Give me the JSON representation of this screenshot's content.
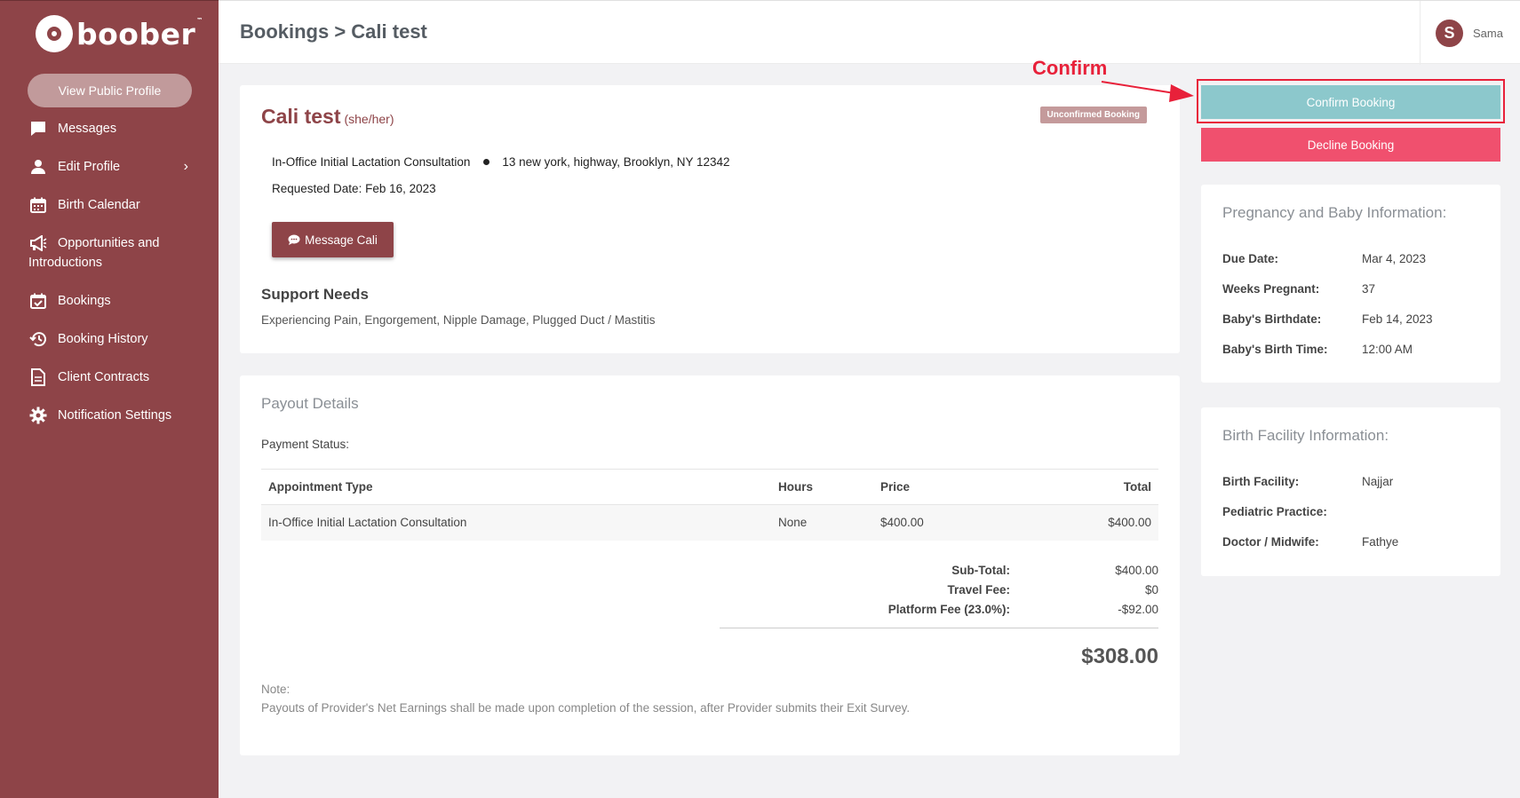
{
  "brand": {
    "name": "boober",
    "tm": "™"
  },
  "sidebar": {
    "public_profile_label": "View Public Profile",
    "items": [
      {
        "label": "Messages",
        "icon": "chat-icon"
      },
      {
        "label": "Edit Profile",
        "icon": "person-icon",
        "chevron": "›"
      },
      {
        "label": "Birth Calendar",
        "icon": "calendar-icon"
      },
      {
        "label": "Opportunities and Introductions",
        "icon": "megaphone-icon"
      },
      {
        "label": "Bookings",
        "icon": "calendar-check-icon"
      },
      {
        "label": "Booking History",
        "icon": "history-icon"
      },
      {
        "label": "Client Contracts",
        "icon": "document-icon"
      },
      {
        "label": "Notification Settings",
        "icon": "gear-icon"
      }
    ]
  },
  "header": {
    "breadcrumb": "Bookings > Cali test",
    "user_initial": "S",
    "user_name": "Sama"
  },
  "client": {
    "name": "Cali test",
    "pronoun": "(she/her)",
    "status": "Unconfirmed Booking",
    "service": "In-Office Initial Lactation Consultation",
    "address": "13 new york, highway, Brooklyn, NY 12342",
    "requested_date": "Requested Date: Feb 16, 2023",
    "message_button": "Message Cali",
    "support_title": "Support Needs",
    "support_text": "Experiencing Pain, Engorgement, Nipple Damage, Plugged Duct / Mastitis"
  },
  "payout": {
    "title": "Payout Details",
    "payment_status_label": "Payment Status:",
    "columns": [
      "Appointment Type",
      "Hours",
      "Price",
      "Total"
    ],
    "rows": [
      [
        "In-Office Initial Lactation Consultation",
        "None",
        "$400.00",
        "$400.00"
      ]
    ],
    "totals": [
      {
        "label": "Sub-Total:",
        "value": "$400.00"
      },
      {
        "label": "Travel Fee:",
        "value": "$0"
      },
      {
        "label": "Platform Fee (23.0%):",
        "value": "-$92.00"
      }
    ],
    "grand_total": "$308.00",
    "note_label": "Note:",
    "note_text": "Payouts of Provider's Net Earnings shall be made upon completion of the session, after Provider submits their Exit Survey."
  },
  "actions": {
    "confirm_label": "Confirm Booking",
    "decline_label": "Decline Booking",
    "annotation": "Confirm"
  },
  "pregnancy": {
    "title": "Pregnancy and Baby Information:",
    "rows": [
      {
        "key": "Due Date:",
        "value": "Mar 4, 2023"
      },
      {
        "key": "Weeks Pregnant:",
        "value": "37"
      },
      {
        "key": "Baby's Birthdate:",
        "value": "Feb 14, 2023"
      },
      {
        "key": "Baby's Birth Time:",
        "value": "12:00 AM"
      }
    ]
  },
  "facility": {
    "title": "Birth Facility Information:",
    "rows": [
      {
        "key": "Birth Facility:",
        "value": "Najjar"
      },
      {
        "key": "Pediatric Practice:",
        "value": ""
      },
      {
        "key": "Doctor / Midwife:",
        "value": "Fathye"
      }
    ]
  },
  "colors": {
    "brand": "#8e4448",
    "confirm": "#8cc8cc",
    "decline": "#f0506e",
    "annotation": "#e8213a",
    "badge": "#c49a9b"
  }
}
